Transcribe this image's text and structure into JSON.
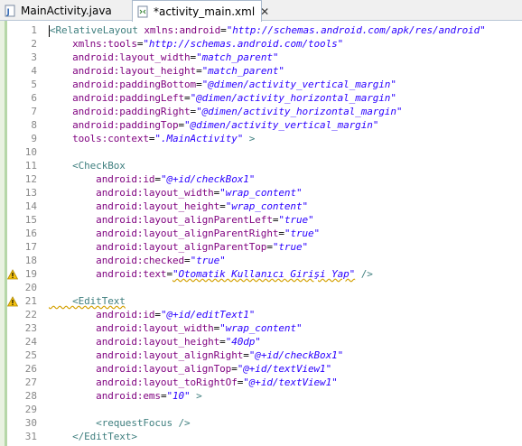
{
  "tabs": [
    {
      "label": "MainActivity.java",
      "icon": "java-file-icon"
    },
    {
      "label": "*activity_main.xml",
      "icon": "xml-file-icon",
      "close": "✕"
    }
  ],
  "lines": [
    {
      "n": "1",
      "t": [
        [
          "<",
          "tag"
        ],
        [
          "RelativeLayout ",
          "tag"
        ],
        [
          "xmlns:android",
          "attr"
        ],
        [
          "=",
          "eq"
        ],
        [
          "\"http://schemas.android.com/apk/res/android\"",
          "val"
        ]
      ]
    },
    {
      "n": "2",
      "t": [
        [
          "    xmlns:tools",
          "attr"
        ],
        [
          "=",
          "eq"
        ],
        [
          "\"http://schemas.android.com/tools\"",
          "val"
        ]
      ]
    },
    {
      "n": "3",
      "t": [
        [
          "    android:layout_width",
          "attr"
        ],
        [
          "=",
          "eq"
        ],
        [
          "\"match_parent\"",
          "val"
        ]
      ]
    },
    {
      "n": "4",
      "t": [
        [
          "    android:layout_height",
          "attr"
        ],
        [
          "=",
          "eq"
        ],
        [
          "\"match_parent\"",
          "val"
        ]
      ]
    },
    {
      "n": "5",
      "t": [
        [
          "    android:paddingBottom",
          "attr"
        ],
        [
          "=",
          "eq"
        ],
        [
          "\"@dimen/activity_vertical_margin\"",
          "val"
        ]
      ]
    },
    {
      "n": "6",
      "t": [
        [
          "    android:paddingLeft",
          "attr"
        ],
        [
          "=",
          "eq"
        ],
        [
          "\"@dimen/activity_horizontal_margin\"",
          "val"
        ]
      ]
    },
    {
      "n": "7",
      "t": [
        [
          "    android:paddingRight",
          "attr"
        ],
        [
          "=",
          "eq"
        ],
        [
          "\"@dimen/activity_horizontal_margin\"",
          "val"
        ]
      ]
    },
    {
      "n": "8",
      "t": [
        [
          "    android:paddingTop",
          "attr"
        ],
        [
          "=",
          "eq"
        ],
        [
          "\"@dimen/activity_vertical_margin\"",
          "val"
        ]
      ]
    },
    {
      "n": "9",
      "t": [
        [
          "    tools:context",
          "attr"
        ],
        [
          "=",
          "eq"
        ],
        [
          "\".MainActivity\"",
          "val"
        ],
        [
          " >",
          "tag"
        ]
      ]
    },
    {
      "n": "10",
      "t": []
    },
    {
      "n": "11",
      "t": [
        [
          "    <CheckBox",
          "tag"
        ]
      ]
    },
    {
      "n": "12",
      "t": [
        [
          "        android:id",
          "attr"
        ],
        [
          "=",
          "eq"
        ],
        [
          "\"@+id/checkBox1\"",
          "val"
        ]
      ]
    },
    {
      "n": "13",
      "t": [
        [
          "        android:layout_width",
          "attr"
        ],
        [
          "=",
          "eq"
        ],
        [
          "\"wrap_content\"",
          "val"
        ]
      ]
    },
    {
      "n": "14",
      "t": [
        [
          "        android:layout_height",
          "attr"
        ],
        [
          "=",
          "eq"
        ],
        [
          "\"wrap_content\"",
          "val"
        ]
      ]
    },
    {
      "n": "15",
      "t": [
        [
          "        android:layout_alignParentLeft",
          "attr"
        ],
        [
          "=",
          "eq"
        ],
        [
          "\"true\"",
          "val"
        ]
      ]
    },
    {
      "n": "16",
      "t": [
        [
          "        android:layout_alignParentRight",
          "attr"
        ],
        [
          "=",
          "eq"
        ],
        [
          "\"true\"",
          "val"
        ]
      ]
    },
    {
      "n": "17",
      "t": [
        [
          "        android:layout_alignParentTop",
          "attr"
        ],
        [
          "=",
          "eq"
        ],
        [
          "\"true\"",
          "val"
        ]
      ]
    },
    {
      "n": "18",
      "t": [
        [
          "        android:checked",
          "attr"
        ],
        [
          "=",
          "eq"
        ],
        [
          "\"true\"",
          "val"
        ]
      ]
    },
    {
      "n": "19",
      "t": [
        [
          "        android:text",
          "attr"
        ],
        [
          "=",
          "eq"
        ],
        [
          "\"Otomatik Kullanıcı Girişi Yap\"",
          "val"
        ],
        [
          " />",
          "tag"
        ]
      ],
      "warn": true
    },
    {
      "n": "20",
      "t": []
    },
    {
      "n": "21",
      "t": [
        [
          "    <EditText",
          "tag"
        ]
      ],
      "warn": true
    },
    {
      "n": "22",
      "t": [
        [
          "        android:id",
          "attr"
        ],
        [
          "=",
          "eq"
        ],
        [
          "\"@+id/editText1\"",
          "val"
        ]
      ]
    },
    {
      "n": "23",
      "t": [
        [
          "        android:layout_width",
          "attr"
        ],
        [
          "=",
          "eq"
        ],
        [
          "\"wrap_content\"",
          "val"
        ]
      ]
    },
    {
      "n": "24",
      "t": [
        [
          "        android:layout_height",
          "attr"
        ],
        [
          "=",
          "eq"
        ],
        [
          "\"40dp\"",
          "val"
        ]
      ]
    },
    {
      "n": "25",
      "t": [
        [
          "        android:layout_alignRight",
          "attr"
        ],
        [
          "=",
          "eq"
        ],
        [
          "\"@+id/checkBox1\"",
          "val"
        ]
      ]
    },
    {
      "n": "26",
      "t": [
        [
          "        android:layout_alignTop",
          "attr"
        ],
        [
          "=",
          "eq"
        ],
        [
          "\"@+id/textView1\"",
          "val"
        ]
      ]
    },
    {
      "n": "27",
      "t": [
        [
          "        android:layout_toRightOf",
          "attr"
        ],
        [
          "=",
          "eq"
        ],
        [
          "\"@+id/textView1\"",
          "val"
        ]
      ]
    },
    {
      "n": "28",
      "t": [
        [
          "        android:ems",
          "attr"
        ],
        [
          "=",
          "eq"
        ],
        [
          "\"10\"",
          "val"
        ],
        [
          " >",
          "tag"
        ]
      ]
    },
    {
      "n": "29",
      "t": []
    },
    {
      "n": "30",
      "t": [
        [
          "        <requestFocus />",
          "tag"
        ]
      ]
    },
    {
      "n": "31",
      "t": [
        [
          "    </EditText>",
          "tag"
        ]
      ]
    }
  ]
}
